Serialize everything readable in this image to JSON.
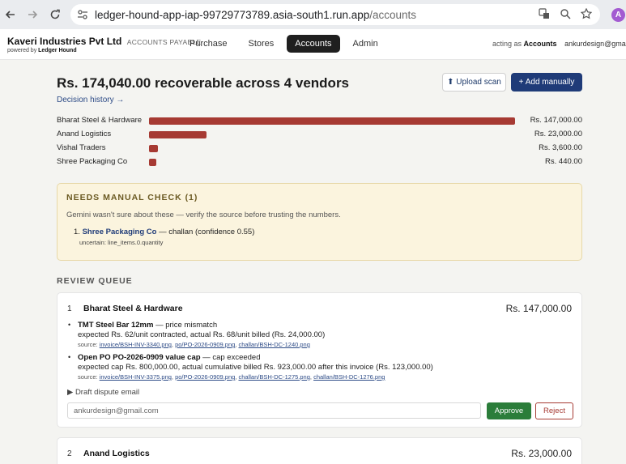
{
  "browser": {
    "url_domain": "ledger-hound-app-iap-99729773789.asia-south1.run.app",
    "url_path": "/accounts",
    "profile_initial": "A",
    "icons": [
      "back-arrow-icon",
      "forward-arrow-icon",
      "reload-icon",
      "site-settings-icon",
      "translate-icon",
      "zoom-icon",
      "bookmark-star-icon"
    ]
  },
  "header": {
    "company": "Kaveri Industries Pvt Ltd",
    "module": "ACCOUNTS PAYABLE",
    "powered_prefix": "powered by",
    "powered_brand": "Ledger Hound",
    "tabs": [
      {
        "label": "Purchase",
        "active": false
      },
      {
        "label": "Stores",
        "active": false
      },
      {
        "label": "Accounts",
        "active": true
      },
      {
        "label": "Admin",
        "active": false
      }
    ],
    "acting_prefix": "acting as",
    "acting_role": "Accounts",
    "user_email": "ankurdesign@gmail.co"
  },
  "summary": {
    "headline": "Rs. 174,040.00 recoverable across 4 vendors",
    "upload_label": "⬆ Upload scan",
    "add_label": "+ Add manually",
    "history_label": "Decision history →"
  },
  "vendors": [
    {
      "name": "Bharat Steel & Hardware",
      "amount": "Rs. 147,000.00",
      "value": 147000
    },
    {
      "name": "Anand Logistics",
      "amount": "Rs. 23,000.00",
      "value": 23000
    },
    {
      "name": "Vishal Traders",
      "amount": "Rs. 3,600.00",
      "value": 3600
    },
    {
      "name": "Shree Packaging Co",
      "amount": "Rs. 440.00",
      "value": 440
    }
  ],
  "manual_check": {
    "title": "NEEDS MANUAL CHECK (1)",
    "description": "Gemini wasn't sure about these — verify the source before trusting the numbers.",
    "item_number": "1.",
    "item_vendor": "Shree Packaging Co",
    "item_rest": " — challan (confidence 0.55)",
    "item_note": "uncertain: line_items.0.quantity"
  },
  "review_queue": {
    "title": "REVIEW QUEUE",
    "cards": [
      {
        "num": "1",
        "vendor": "Bharat Steel & Hardware",
        "amount": "Rs. 147,000.00",
        "issues": [
          {
            "title": "TMT Steel Bar 12mm",
            "kind": " — price mismatch",
            "detail": "expected Rs. 62/unit contracted, actual Rs. 68/unit billed (Rs. 24,000.00)",
            "source_label": "source:",
            "sources": [
              "invoice/BSH-INV-3340.png",
              "po/PO-2026-0909.png",
              "challan/BSH-DC-1240.png"
            ]
          },
          {
            "title": "Open PO PO-2026-0909 value cap",
            "kind": " — cap exceeded",
            "detail": "expected cap Rs. 800,000.00, actual cumulative billed Rs. 923,000.00 after this invoice (Rs. 123,000.00)",
            "source_label": "source:",
            "sources": [
              "invoice/BSH-INV-3375.png",
              "po/PO-2026-0909.png",
              "challan/BSH-DC-1275.png",
              "challan/BSH-DC-1276.png"
            ]
          }
        ],
        "draft_label": "▶ Draft dispute email",
        "email_value": "ankurdesign@gmail.com",
        "approve_label": "Approve",
        "reject_label": "Reject"
      },
      {
        "num": "2",
        "vendor": "Anand Logistics",
        "amount": "Rs. 23,000.00"
      }
    ]
  },
  "colors": {
    "bar": "#a63a33",
    "primary": "#1f3b78",
    "approve": "#2b7d3a",
    "warning_bg": "#fbf4de"
  }
}
